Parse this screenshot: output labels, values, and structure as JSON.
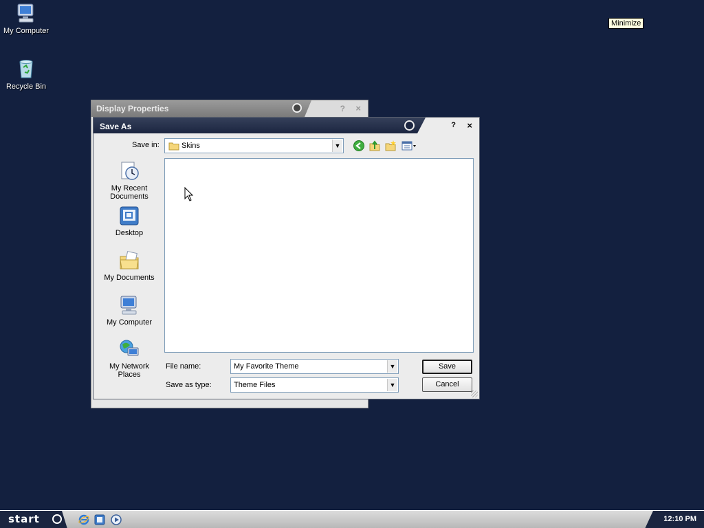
{
  "desktop": {
    "icons": [
      {
        "label": "My Computer",
        "icon": "my-computer-icon"
      },
      {
        "label": "Recycle Bin",
        "icon": "recycle-bin-icon"
      }
    ]
  },
  "tooltip": {
    "text": "Minimize"
  },
  "back_window": {
    "title": "Display Properties",
    "help": "?",
    "close": "×"
  },
  "dialog": {
    "title": "Save As",
    "help": "?",
    "close": "×",
    "save_in_label": "Save in:",
    "save_in_value": "Skins",
    "toolbar": [
      "back-icon",
      "up-folder-icon",
      "new-folder-icon",
      "view-menu-icon"
    ],
    "places": [
      {
        "label": "My Recent Documents",
        "icon": "recent-documents-icon"
      },
      {
        "label": "Desktop",
        "icon": "desktop-icon"
      },
      {
        "label": "My Documents",
        "icon": "my-documents-icon"
      },
      {
        "label": "My Computer",
        "icon": "my-computer-icon"
      },
      {
        "label": "My Network Places",
        "icon": "network-places-icon"
      }
    ],
    "file_name_label": "File name:",
    "file_name_value": "My Favorite Theme",
    "save_as_type_label": "Save as type:",
    "save_as_type_value": "Theme Files",
    "save_button": "Save",
    "cancel_button": "Cancel"
  },
  "taskbar": {
    "start_label": "start",
    "quick_launch": [
      "internet-explorer-icon",
      "show-desktop-icon",
      "media-player-icon"
    ],
    "clock": "12:10 PM"
  },
  "colors": {
    "desktop": "#13203f",
    "titlebar": "#1b2540",
    "dialog_bg": "#ececec"
  }
}
